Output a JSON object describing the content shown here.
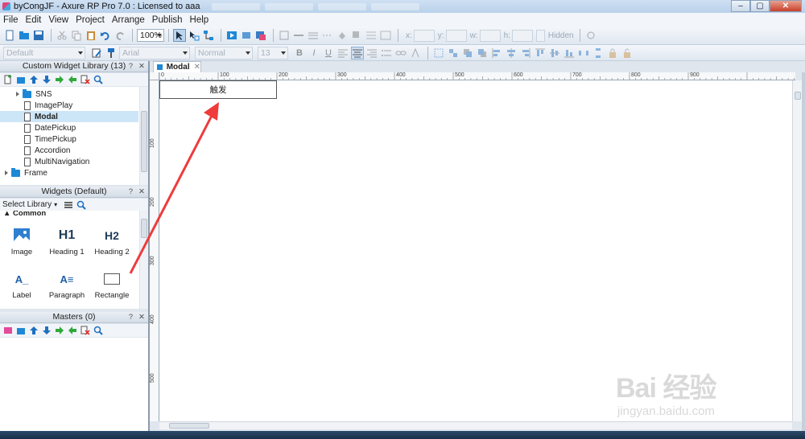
{
  "window": {
    "title": "byCongJF - Axure RP Pro 7.0 : Licensed to aaa",
    "minimize": "–",
    "maximize": "▢",
    "close": "✕"
  },
  "menu": [
    "File",
    "Edit",
    "View",
    "Project",
    "Arrange",
    "Publish",
    "Help"
  ],
  "toolbar": {
    "zoom": "100%",
    "style_combo": "Default",
    "font_combo": "Arial",
    "weight_combo": "Normal",
    "size_combo": "13",
    "x_label": "x:",
    "y_label": "y:",
    "w_label": "w:",
    "h_label": "h:",
    "hidden_label": "Hidden",
    "bold": "B",
    "italic": "I",
    "underline": "U"
  },
  "custom_library": {
    "title": "Custom Widget Library (13)",
    "ctrl_help": "?",
    "ctrl_close": "✕",
    "items": [
      {
        "label": "SNS",
        "kind": "folder"
      },
      {
        "label": "ImagePlay",
        "kind": "page"
      },
      {
        "label": "Modal",
        "kind": "page",
        "selected": true
      },
      {
        "label": "DatePickup",
        "kind": "page"
      },
      {
        "label": "TimePickup",
        "kind": "page"
      },
      {
        "label": "Accordion",
        "kind": "page"
      },
      {
        "label": "MultiNavigation",
        "kind": "page"
      },
      {
        "label": "Frame",
        "kind": "folder"
      }
    ]
  },
  "widgets": {
    "title": "Widgets (Default)",
    "select_library": "Select Library",
    "category": "Common",
    "items": [
      {
        "label": "Image",
        "icon": "image-icon"
      },
      {
        "label": "Heading 1",
        "icon": "heading1-icon",
        "glyph": "H1"
      },
      {
        "label": "Heading 2",
        "icon": "heading2-icon",
        "glyph": "H2"
      },
      {
        "label": "Label",
        "icon": "label-icon",
        "glyph": "A_"
      },
      {
        "label": "Paragraph",
        "icon": "paragraph-icon",
        "glyph": "A≡"
      },
      {
        "label": "Rectangle",
        "icon": "rectangle-icon"
      }
    ]
  },
  "masters": {
    "title": "Masters (0)"
  },
  "canvas": {
    "tab_label": "Modal",
    "tab_close": "✕",
    "trigger_button_text": "触发",
    "ruler_top": [
      "0",
      "100",
      "200",
      "300",
      "400",
      "500",
      "600",
      "700",
      "800",
      "900"
    ],
    "ruler_left": [
      "100",
      "200",
      "300",
      "400",
      "500"
    ]
  },
  "watermark": {
    "brand": "Bai 经验",
    "url": "jingyan.baidu.com"
  },
  "colors": {
    "accent_blue": "#1e88d6",
    "selected_row": "#cde6f7",
    "annotation_arrow": "#ee3b3b"
  }
}
